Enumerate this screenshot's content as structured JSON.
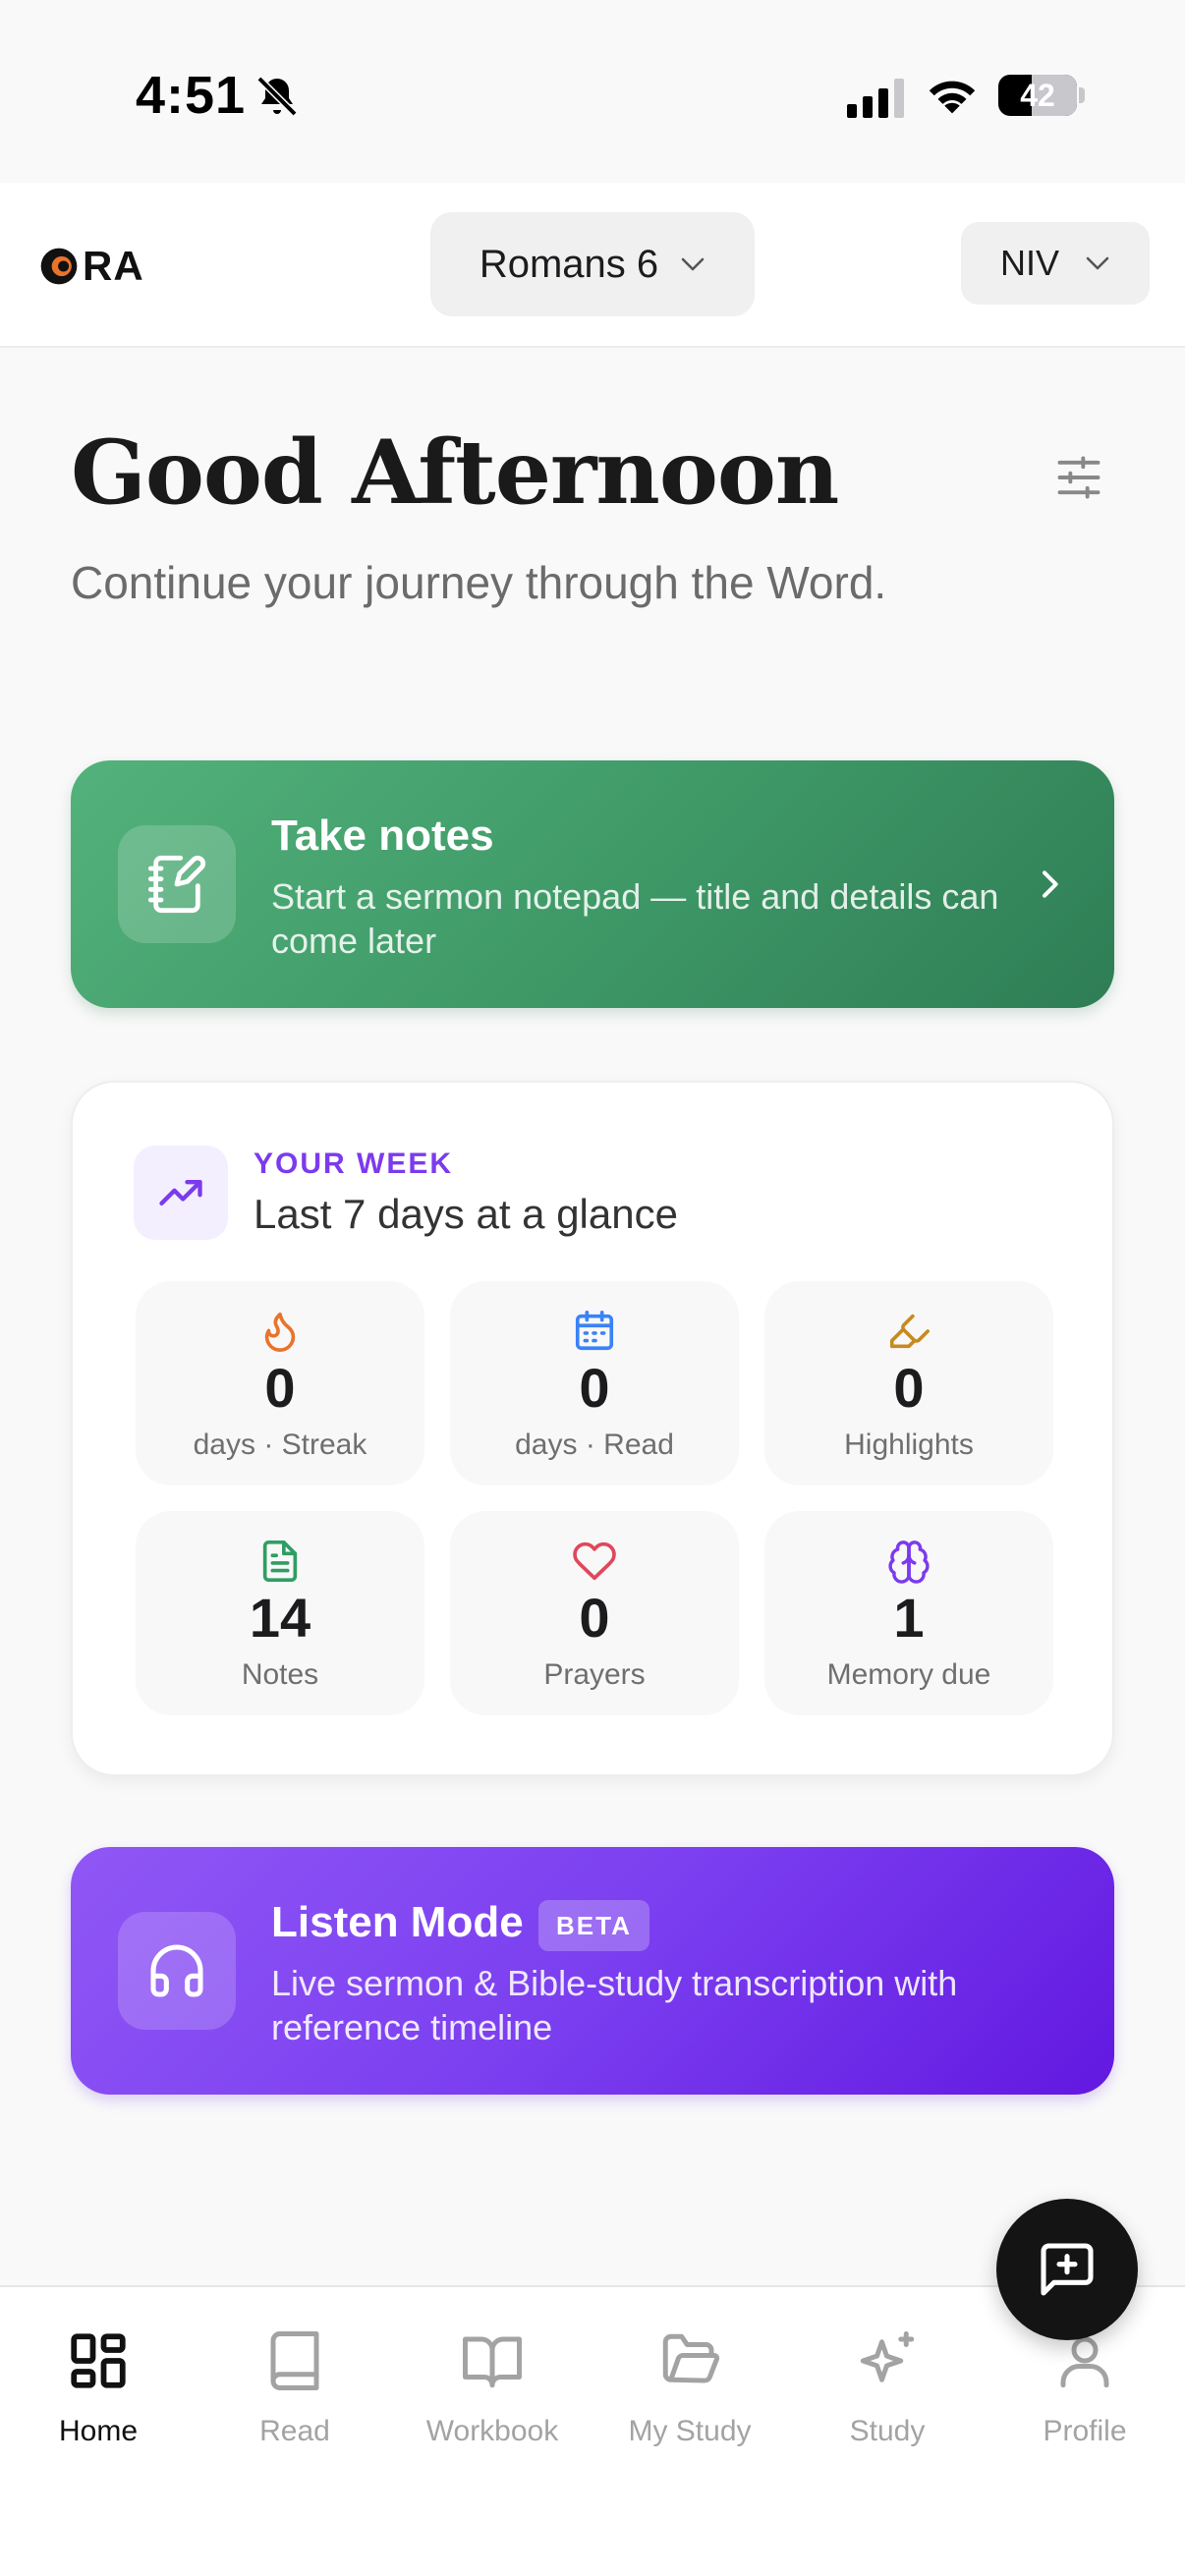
{
  "status_bar": {
    "time": "4:51",
    "battery": "42",
    "battery_level": 0.42
  },
  "header": {
    "logo_text": "RA",
    "book": "Romans 6",
    "version": "NIV"
  },
  "greeting": {
    "title": "Good Afternoon",
    "subtitle": "Continue your journey through the Word."
  },
  "notes_card": {
    "title": "Take notes",
    "description": "Start a sermon notepad — title and details can come later",
    "icon": "notebook-pen-icon",
    "colors": {
      "start": "#53b27b",
      "end": "#2f7d55"
    }
  },
  "week_card": {
    "label": "YOUR WEEK",
    "title": "Last 7 days at a glance",
    "stats": [
      {
        "value": "0",
        "label": "days · Streak",
        "icon": "flame-icon",
        "color": "#e8742c"
      },
      {
        "value": "0",
        "label": "days · Read",
        "icon": "calendar-icon",
        "color": "#3b82f6"
      },
      {
        "value": "0",
        "label": "Highlights",
        "icon": "highlighter-icon",
        "color": "#c88a1f"
      },
      {
        "value": "14",
        "label": "Notes",
        "icon": "file-text-icon",
        "color": "#2f9e63"
      },
      {
        "value": "0",
        "label": "Prayers",
        "icon": "heart-icon",
        "color": "#e0475b"
      },
      {
        "value": "1",
        "label": "Memory due",
        "icon": "brain-icon",
        "color": "#7c3aed"
      }
    ]
  },
  "listen_card": {
    "title": "Listen Mode",
    "badge": "BETA",
    "description": "Live sermon & Bible-study transcription with reference timeline",
    "icon": "headphones-icon",
    "colors": {
      "start": "#9057f5",
      "end": "#6218e0"
    }
  },
  "bottom_nav": {
    "items": [
      {
        "label": "Home",
        "icon": "home-grid-icon",
        "active": true
      },
      {
        "label": "Read",
        "icon": "book-icon",
        "active": false
      },
      {
        "label": "Workbook",
        "icon": "open-book-icon",
        "active": false
      },
      {
        "label": "My Study",
        "icon": "folder-open-icon",
        "active": false
      },
      {
        "label": "Study",
        "icon": "sparkles-icon",
        "active": false
      },
      {
        "label": "Profile",
        "icon": "user-icon",
        "active": false
      }
    ]
  },
  "fab": {
    "icon": "message-plus-icon"
  }
}
